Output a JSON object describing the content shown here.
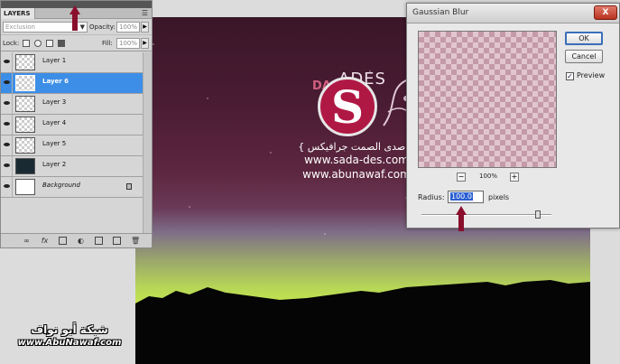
{
  "layers_panel": {
    "tab": "LAYERS",
    "blend_mode": "Exclusion",
    "opacity_label": "Opacity:",
    "opacity_value": "100%",
    "lock_label": "Lock:",
    "fill_label": "Fill:",
    "fill_value": "100%",
    "layers": [
      {
        "name": "Layer 1",
        "selected": false
      },
      {
        "name": "Layer 6",
        "selected": true
      },
      {
        "name": "Layer 3",
        "selected": false
      },
      {
        "name": "Layer 4",
        "selected": false
      },
      {
        "name": "Layer 5",
        "selected": false
      },
      {
        "name": "Layer 2",
        "selected": false
      },
      {
        "name": "Background",
        "selected": false
      }
    ],
    "footer_icons": [
      "link-icon",
      "fx-icon",
      "mask-icon",
      "adjustment-icon",
      "folder-icon",
      "new-layer-icon",
      "trash-icon"
    ]
  },
  "canvas": {
    "logo_ades": "ADES",
    "logo_das": "DAS",
    "logo_letter": "S",
    "arabic_line": "{ صدى الصمت جرافيكس }",
    "url1": "www.sada-des.com",
    "url2": "www.abunawaf.com"
  },
  "gaussian_blur": {
    "title": "Gaussian Blur",
    "ok": "OK",
    "cancel": "Cancel",
    "preview_label": "Preview",
    "preview_checked": "✓",
    "zoom": "100%",
    "zoom_minus": "−",
    "zoom_plus": "+",
    "radius_label": "Radius:",
    "radius_value": "100.0",
    "radius_unit": "pixels",
    "close": "X"
  },
  "watermark": {
    "line1": "شبكة أبو نواف",
    "line2": "www.AbuNawaf.com"
  },
  "colors": {
    "arrow": "#8a0f2c",
    "selection": "#3d8ee6",
    "logo_red": "#b01844"
  }
}
